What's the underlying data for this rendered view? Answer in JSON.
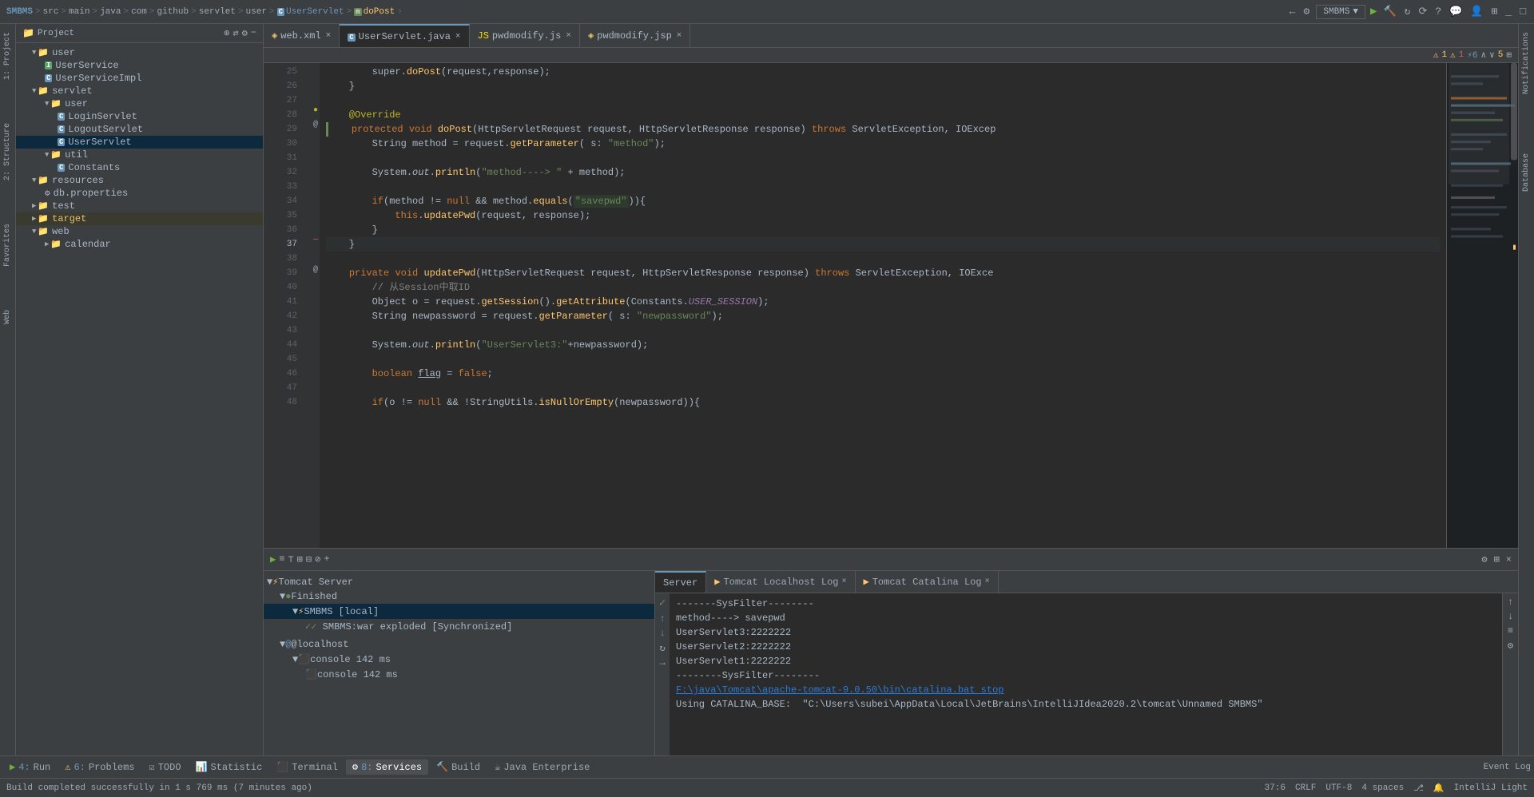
{
  "topbar": {
    "breadcrumb": [
      "SMBMS",
      "src",
      "main",
      "java",
      "com",
      "github",
      "servlet",
      "user",
      "UserServlet",
      "m doPost"
    ],
    "smbms_label": "SMBMS",
    "dropdown_arrow": "▼"
  },
  "tabs": [
    {
      "id": "web-xml",
      "icon": "xml",
      "label": "web.xml",
      "active": false
    },
    {
      "id": "userservlet-java",
      "icon": "java",
      "label": "UserServlet.java",
      "active": true
    },
    {
      "id": "pwdmodify-js",
      "icon": "js",
      "label": "pwdmodify.js",
      "active": false
    },
    {
      "id": "pwdmodify-jsp",
      "icon": "jsp",
      "label": "pwdmodify.jsp",
      "active": false
    }
  ],
  "editor": {
    "warning_bar": {
      "warn1": "⚠ 1",
      "err1": "⚠ 1",
      "info": "⚡ 6",
      "nav_up": "∧",
      "nav_down": "∨",
      "count": "5"
    },
    "lines": [
      {
        "num": 25,
        "code": "        super.doPost(request,response);",
        "type": "plain"
      },
      {
        "num": 26,
        "code": "    }",
        "type": "plain"
      },
      {
        "num": 27,
        "code": "",
        "type": "plain"
      },
      {
        "num": 28,
        "code": "    @Override",
        "type": "annotation",
        "gutter": "●"
      },
      {
        "num": 29,
        "code": "    protected void doPost(HttpServletRequest request, HttpServletResponse response) throws ServletException, IOExcep",
        "type": "method-def",
        "gutter": "@"
      },
      {
        "num": 30,
        "code": "        String method = request.getParameter( s: \"method\");",
        "type": "plain"
      },
      {
        "num": 31,
        "code": "",
        "type": "plain"
      },
      {
        "num": 32,
        "code": "        System.out.println(\"method----> \" + method);",
        "type": "plain"
      },
      {
        "num": 33,
        "code": "",
        "type": "plain"
      },
      {
        "num": 34,
        "code": "        if(method != null && method.equals(\"savepwd\")){",
        "type": "plain",
        "highlight": "savepwd"
      },
      {
        "num": 35,
        "code": "            this.updatePwd(request, response);",
        "type": "plain"
      },
      {
        "num": 36,
        "code": "        }",
        "type": "plain"
      },
      {
        "num": 37,
        "code": "    }",
        "type": "highlight-line"
      },
      {
        "num": 38,
        "code": "",
        "type": "plain"
      },
      {
        "num": 39,
        "code": "    private void updatePwd(HttpServletRequest request, HttpServletResponse response) throws ServletException, IOExce",
        "type": "method-def",
        "gutter": "@"
      },
      {
        "num": 40,
        "code": "        // 从Session中取ID",
        "type": "comment"
      },
      {
        "num": 41,
        "code": "        Object o = request.getSession().getAttribute(Constants.USER_SESSION);",
        "type": "plain"
      },
      {
        "num": 42,
        "code": "        String newpassword = request.getParameter( s: \"newpassword\");",
        "type": "plain"
      },
      {
        "num": 43,
        "code": "",
        "type": "plain"
      },
      {
        "num": 44,
        "code": "        System.out.println(\"UserServlet3:\"+newpassword);",
        "type": "plain"
      },
      {
        "num": 45,
        "code": "",
        "type": "plain"
      },
      {
        "num": 46,
        "code": "        boolean flag = false;",
        "type": "plain"
      },
      {
        "num": 47,
        "code": "",
        "type": "plain"
      },
      {
        "num": 48,
        "code": "        if(o != null && !StringUtils.isNullOrEmpty(newpassword)){",
        "type": "plain"
      }
    ]
  },
  "sidebar": {
    "title": "Project",
    "tree": [
      {
        "level": 1,
        "type": "folder",
        "label": "user",
        "expanded": true,
        "arrow": "▼"
      },
      {
        "level": 2,
        "type": "interface",
        "label": "UserService",
        "icon": "I"
      },
      {
        "level": 2,
        "type": "class",
        "label": "UserServiceImpl",
        "icon": "C"
      },
      {
        "level": 1,
        "type": "folder",
        "label": "servlet",
        "expanded": true,
        "arrow": "▼"
      },
      {
        "level": 2,
        "type": "folder",
        "label": "user",
        "expanded": true,
        "arrow": "▼"
      },
      {
        "level": 3,
        "type": "class",
        "label": "LoginServlet",
        "icon": "C"
      },
      {
        "level": 3,
        "type": "class",
        "label": "LogoutServlet",
        "icon": "C"
      },
      {
        "level": 3,
        "type": "class",
        "label": "UserServlet",
        "icon": "C",
        "selected": true
      },
      {
        "level": 2,
        "type": "folder",
        "label": "util",
        "expanded": true,
        "arrow": "▼"
      },
      {
        "level": 3,
        "type": "class",
        "label": "Constants",
        "icon": "C"
      },
      {
        "level": 1,
        "type": "folder",
        "label": "resources",
        "expanded": true,
        "arrow": "▼"
      },
      {
        "level": 2,
        "type": "prop",
        "label": "db.properties"
      },
      {
        "level": 1,
        "type": "folder",
        "label": "test",
        "expanded": false,
        "arrow": "▶"
      },
      {
        "level": 1,
        "type": "folder",
        "label": "target",
        "expanded": false,
        "arrow": "▶",
        "highlight": true
      },
      {
        "level": 1,
        "type": "folder",
        "label": "web",
        "expanded": true,
        "arrow": "▼"
      },
      {
        "level": 2,
        "type": "folder",
        "label": "calendar",
        "expanded": false,
        "arrow": "▶"
      }
    ]
  },
  "bottom_panel": {
    "header_icons": [
      "▶",
      "≡",
      "⊤",
      "⊞",
      "⊟",
      "⊘",
      "+"
    ],
    "services_tree": [
      {
        "level": 0,
        "label": "Tomcat Server",
        "icon": "server",
        "expanded": true,
        "arrow": "▼"
      },
      {
        "level": 1,
        "label": "Finished",
        "icon": "finished",
        "expanded": true,
        "arrow": "▼"
      },
      {
        "level": 2,
        "label": "SMBMS [local]",
        "icon": "smbms",
        "expanded": true,
        "arrow": "▼",
        "active": true
      },
      {
        "level": 3,
        "label": "SMBMS:war exploded [Synchronized]",
        "icon": "war"
      }
    ],
    "localhost_section": [
      {
        "level": 0,
        "label": "@localhost",
        "expanded": true,
        "arrow": "▼"
      },
      {
        "level": 1,
        "label": "console 142 ms",
        "icon": "console",
        "expanded": true,
        "arrow": "▼"
      },
      {
        "level": 2,
        "label": "console 142 ms",
        "icon": "console"
      }
    ],
    "output_tabs": [
      {
        "id": "server",
        "label": "Server",
        "active": true
      },
      {
        "id": "tomcat-localhost",
        "label": "Tomcat Localhost Log",
        "active": false,
        "closable": true
      },
      {
        "id": "tomcat-catalina",
        "label": "Tomcat Catalina Log",
        "active": false,
        "closable": true
      }
    ],
    "output_lines": [
      {
        "text": "-------SysFilter--------",
        "type": "plain"
      },
      {
        "text": "method----> savepwd",
        "type": "plain"
      },
      {
        "text": "UserServlet3:2222222",
        "type": "plain"
      },
      {
        "text": "UserServlet2:2222222",
        "type": "plain"
      },
      {
        "text": "UserServlet1:2222222",
        "type": "plain"
      },
      {
        "text": "--------SysFilter--------",
        "type": "plain"
      },
      {
        "text": "F:\\java\\Tomcat\\apache-tomcat-9.0.50\\bin\\catalina.bat stop",
        "type": "link"
      },
      {
        "text": "Using CATALINA_BASE:  \"C:\\Users\\subei\\AppData\\Local\\JetBrains\\IntelliJIdea2020.2\\tomcat\\Unnamed SMBMS\"",
        "type": "plain"
      }
    ]
  },
  "bottom_tabs": [
    {
      "id": "run",
      "num": "4",
      "label": "Run",
      "icon": "▶"
    },
    {
      "id": "problems",
      "num": "6",
      "label": "Problems",
      "icon": "⚠"
    },
    {
      "id": "todo",
      "label": "TODO",
      "icon": "☑"
    },
    {
      "id": "statistic",
      "label": "Statistic",
      "icon": "📊"
    },
    {
      "id": "terminal",
      "label": "Terminal",
      "icon": "⬛"
    },
    {
      "id": "services",
      "num": "8",
      "label": "Services",
      "icon": "⚙",
      "active": true
    },
    {
      "id": "build",
      "label": "Build",
      "icon": "🔨"
    },
    {
      "id": "java-enterprise",
      "label": "Java Enterprise",
      "icon": "☕"
    }
  ],
  "status_bar": {
    "message": "Build completed successfully in 1 s 769 ms (7 minutes ago)",
    "position": "37:6",
    "line_ending": "CRLF",
    "encoding": "UTF-8",
    "indent": "4 spaces",
    "theme": "IntelliJ Light"
  },
  "right_sidebar_tabs": [
    "Notifications",
    "Database"
  ],
  "left_sidebar_tabs": [
    "Project",
    "1: Project",
    "2: Structure",
    "Favorites",
    "Web"
  ]
}
